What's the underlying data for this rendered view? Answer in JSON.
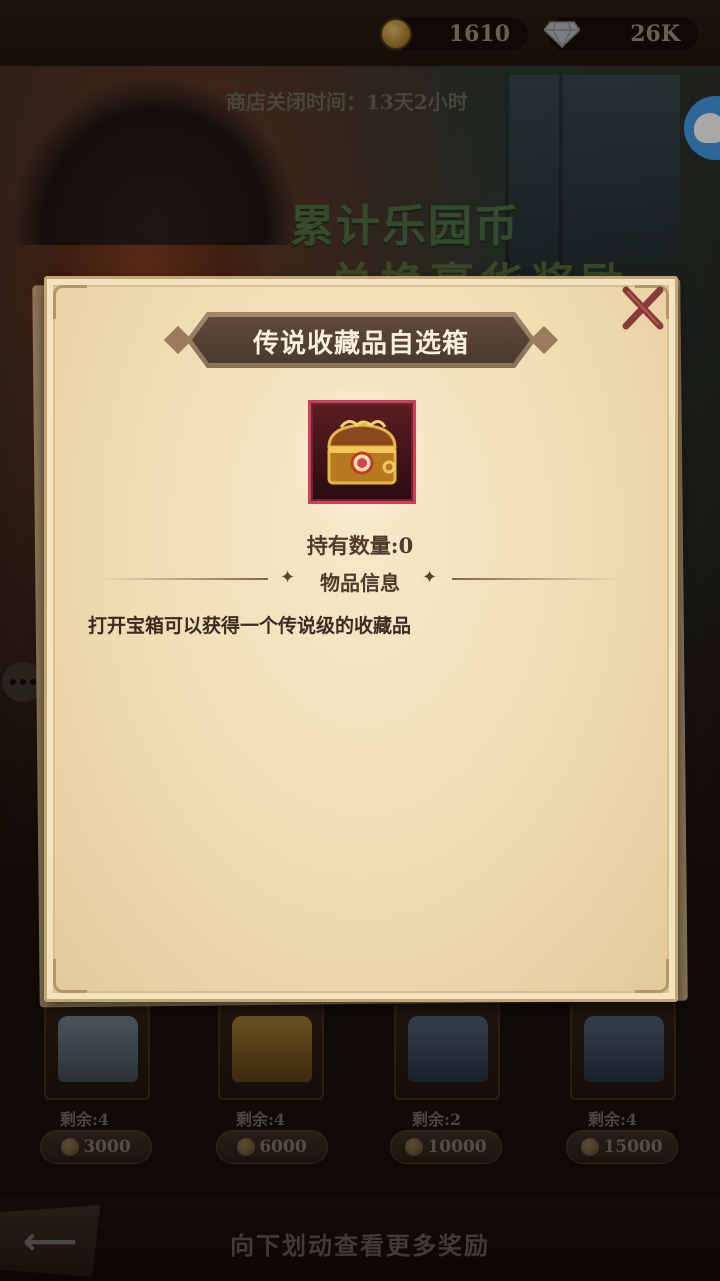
{
  "currency": {
    "coins": "1610",
    "diamonds": "26K",
    "coin_icon": "coin-icon",
    "diamond_icon": "diamond-icon"
  },
  "shop": {
    "close_timer": "商店关闭时间：13天2小时",
    "banner_line1": "累计乐园币",
    "banner_line2": "兑换豪华奖励",
    "items": [
      {
        "remain": "剩余:4",
        "price": "3000",
        "chest": "silver-chest"
      },
      {
        "remain": "剩余:4",
        "price": "6000",
        "chest": "gold-chest"
      },
      {
        "remain": "剩余:2",
        "price": "10000",
        "chest": "steel-chest"
      },
      {
        "remain": "剩余:4",
        "price": "15000",
        "chest": "steel-chest"
      }
    ],
    "scroll_hint": "向下划动查看更多奖励"
  },
  "dialog": {
    "title": "传说收藏品自选箱",
    "own_count": "持有数量:0",
    "info_label": "物品信息",
    "description": "打开宝箱可以获得一个传说级的收藏品",
    "close_icon": "close-icon",
    "item_icon": "legendary-chest-icon"
  },
  "colors": {
    "parchment": "#efdcb2",
    "title_plate": "#4a392c",
    "item_frame_border": "#c9405a",
    "close_x": "#8a3a38",
    "bubble_button": "#3f9be8"
  }
}
